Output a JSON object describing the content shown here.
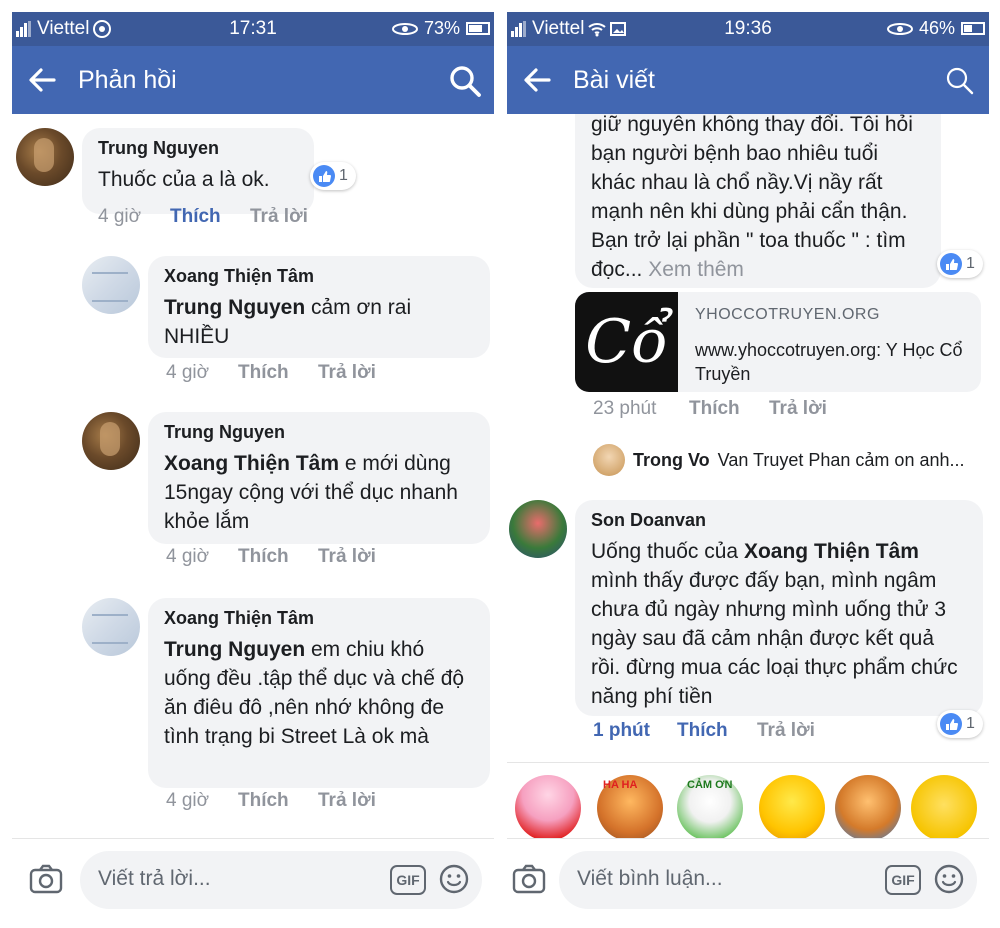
{
  "left": {
    "status": {
      "carrier": "Viettel",
      "time": "17:31",
      "battery": "73%",
      "battery_fraction": 0.73
    },
    "header": {
      "title": "Phản hồi"
    },
    "comments": [
      {
        "author": "Trung Nguyen",
        "text": "Thuốc của  a là  ok.",
        "time": "4 giờ",
        "like": "Thích",
        "reply": "Trả lời",
        "reactions": "1"
      },
      {
        "author": "Xoang Thiện Tâm",
        "mention": "Trung Nguyen",
        "text": " cảm ơn rai NHIỀU",
        "time": "4 giờ",
        "like": "Thích",
        "reply": "Trả lời"
      },
      {
        "author": "Trung Nguyen",
        "mention": "Xoang Thiện Tâm",
        "text": " e mới  dùng 15ngay  cộng với thể dục nhanh khỏe  lắm",
        "time": "4 giờ",
        "like": "Thích",
        "reply": "Trả lời"
      },
      {
        "author": "Xoang Thiện Tâm",
        "mention": "Trung Nguyen",
        "text": " em chiu khó uống đều .tập thể dục và chế độ ăn điêu đô ,nên nhớ không đe tình trạng bi Street  Là ok mà",
        "time": "4 giờ",
        "like": "Thích",
        "reply": "Trả lời"
      }
    ],
    "composer": {
      "placeholder": "Viết trả lời...",
      "gif": "GIF"
    }
  },
  "right": {
    "status": {
      "carrier": "Viettel",
      "time": "19:36",
      "battery": "46%",
      "battery_fraction": 0.46
    },
    "header": {
      "title": "Bài viết"
    },
    "post": {
      "text": "giữ nguyên không thay đổi. Tôi hỏi bạn người bệnh bao nhiêu tuổi khác nhau là chổ nầy.Vị nầy rất mạnh nên khi dùng phải cẩn thận. Bạn trở lại phần \" toa thuốc \" : tìm đọc...",
      "see_more": "Xem thêm",
      "reactions": "1",
      "link": {
        "thumb": "Cổ",
        "domain": "YHOCCOTRUYEN.ORG",
        "title": "www.yhoccotruyen.org: Y Học Cổ Truyền"
      },
      "time": "23 phút",
      "like": "Thích",
      "reply": "Trả lời",
      "reply_preview": {
        "author": "Trong Vo",
        "text": "Van Truyet Phan cảm on anh..."
      }
    },
    "comment": {
      "author": "Son Doanvan",
      "prefix": "Uống thuốc của ",
      "mention": "Xoang Thiện Tâm",
      "text": " mình thấy được đấy bạn, mình ngâm chưa đủ ngày nhưng mình uống thử 3 ngày sau đã cảm nhận được kết quả rồi. đừng mua các loại thực phẩm chức năng phí tiền",
      "time": "1 phút",
      "like": "Thích",
      "reply": "Trả lời",
      "reactions": "1"
    },
    "stickers": [
      "sticker-heart-girl",
      "sticker-haha-dog",
      "sticker-cam-on",
      "sticker-love-chick",
      "sticker-thumbs-dog",
      "sticker-laughing-face"
    ],
    "sticker_text": {
      "haha": "HA HA",
      "camon": "CẢM ƠN"
    },
    "composer": {
      "placeholder": "Viết bình luận...",
      "gif": "GIF"
    }
  },
  "icons": {
    "back": "arrow-left-icon",
    "search": "search-icon",
    "camera": "camera-icon",
    "emoji": "smiley-icon",
    "like": "thumbs-up-icon"
  },
  "colors": {
    "status_bar": "#3b5998",
    "app_bar": "#4267b2",
    "bubble": "#f2f3f5",
    "link": "#4267b2",
    "muted": "#90949c"
  }
}
